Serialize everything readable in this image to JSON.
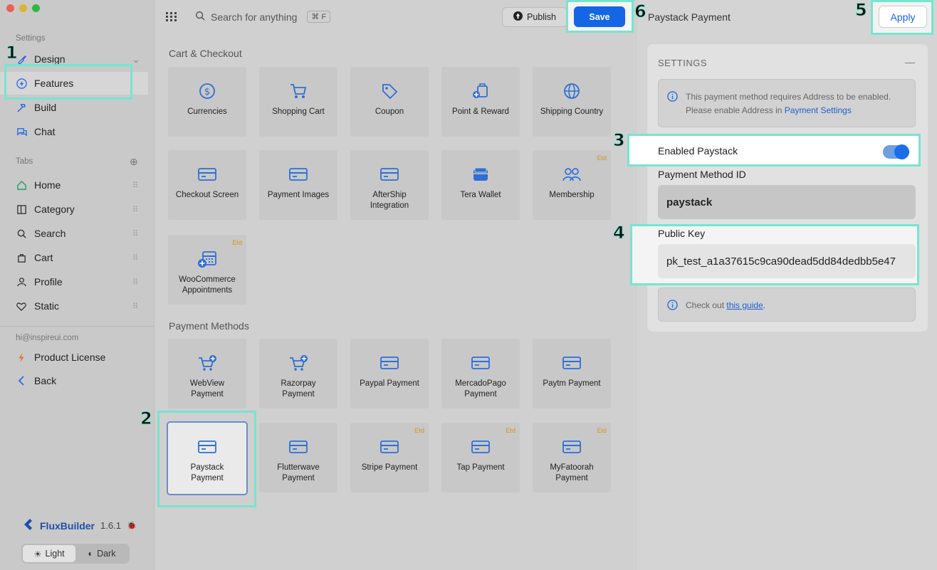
{
  "sidebar": {
    "settings_label": "Settings",
    "items": [
      {
        "label": "Design"
      },
      {
        "label": "Features"
      },
      {
        "label": "Build"
      },
      {
        "label": "Chat"
      }
    ],
    "tabs_label": "Tabs",
    "tabs": [
      {
        "label": "Home"
      },
      {
        "label": "Category"
      },
      {
        "label": "Search"
      },
      {
        "label": "Cart"
      },
      {
        "label": "Profile"
      },
      {
        "label": "Static"
      }
    ],
    "email": "hi@inspireui.com",
    "product_license": "Product License",
    "back": "Back",
    "brand": "FluxBuilder",
    "version": "1.6.1",
    "theme": {
      "light": "Light",
      "dark": "Dark"
    }
  },
  "topbar": {
    "search_placeholder": "Search for anything",
    "shortcut": "⌘ F",
    "publish": "Publish",
    "save": "Save"
  },
  "groups": {
    "cart_title": "Cart & Checkout",
    "cart_cards": [
      {
        "label": "Currencies",
        "icon": "dollar-icon"
      },
      {
        "label": "Shopping Cart",
        "icon": "cart-icon"
      },
      {
        "label": "Coupon",
        "icon": "tag-icon"
      },
      {
        "label": "Point & Reward",
        "icon": "gift-icon"
      },
      {
        "label": "Shipping Country",
        "icon": "globe-icon"
      },
      {
        "label": "Checkout Screen",
        "icon": "card-icon"
      },
      {
        "label": "Payment Images",
        "icon": "card-icon"
      },
      {
        "label": "AfterShip Integration",
        "icon": "card-icon"
      },
      {
        "label": "Tera Wallet",
        "icon": "wallet-icon"
      },
      {
        "label": "Membership",
        "icon": "users-icon",
        "badge": "Etd"
      },
      {
        "label": "WooCommerce Appointments",
        "icon": "calendar-icon",
        "badge": "Etd"
      }
    ],
    "payment_title": "Payment Methods",
    "payment_cards": [
      {
        "label": "WebView Payment",
        "icon": "cart-plus-icon"
      },
      {
        "label": "Razorpay Payment",
        "icon": "cart-plus-icon"
      },
      {
        "label": "Paypal Payment",
        "icon": "card-icon"
      },
      {
        "label": "MercadoPago Payment",
        "icon": "card-icon"
      },
      {
        "label": "Paytm Payment",
        "icon": "card-icon"
      },
      {
        "label": "Paystack Payment",
        "icon": "card-icon"
      },
      {
        "label": "Flutterwave Payment",
        "icon": "card-icon"
      },
      {
        "label": "Stripe Payment",
        "icon": "card-icon",
        "badge": "Etd"
      },
      {
        "label": "Tap Payment",
        "icon": "card-icon",
        "badge": "Etd"
      },
      {
        "label": "MyFatoorah Payment",
        "icon": "card-icon",
        "badge": "Etd"
      }
    ]
  },
  "panel": {
    "title": "Paystack Payment",
    "apply": "Apply",
    "settings_head": "SETTINGS",
    "info_text": "This payment method requires Address to be enabled. Please enable Address in",
    "info_link": "Payment Settings",
    "enabled_label": "Enabled Paystack",
    "enabled": true,
    "method_id_label": "Payment Method ID",
    "method_id_value": "paystack",
    "public_key_label": "Public Key",
    "public_key_value": "pk_test_a1a37615c9ca90dead5dd84dedbb5e47",
    "guide_text": "Check out",
    "guide_link": "this guide",
    "guide_end": "."
  },
  "callouts": [
    "1",
    "2",
    "3",
    "4",
    "5",
    "6"
  ],
  "colors": {
    "accent": "#1466e5",
    "highlight": "#76e5cf",
    "etd": "#d99316"
  }
}
